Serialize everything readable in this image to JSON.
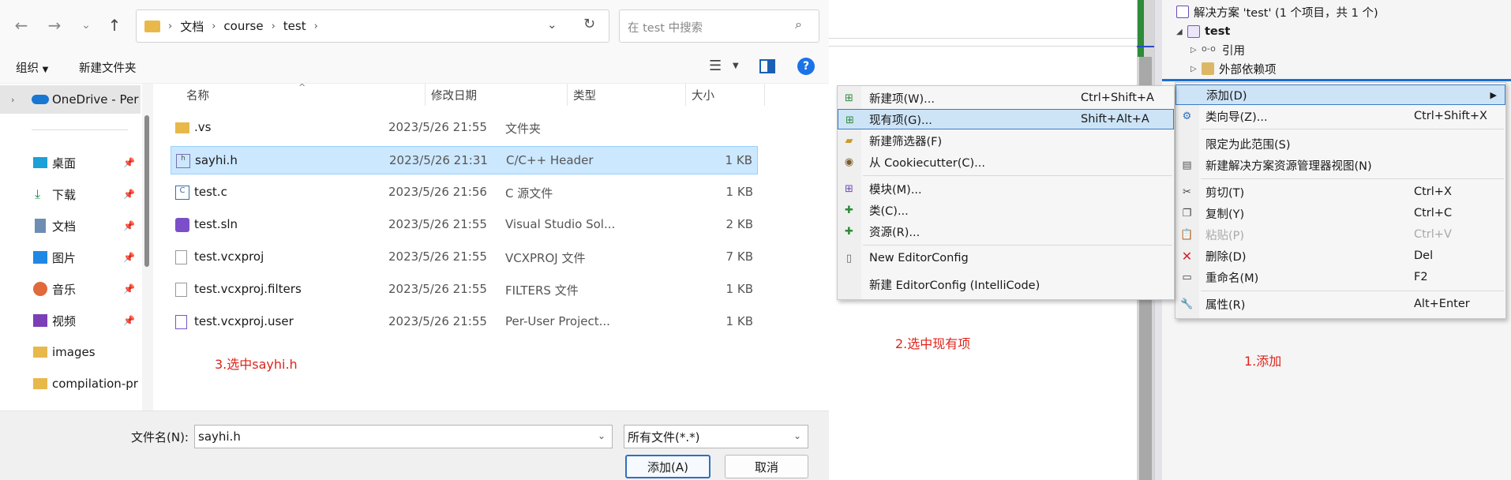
{
  "dialog": {
    "breadcrumb": [
      "文档",
      "course",
      "test"
    ],
    "search_placeholder": "在 test 中搜索",
    "toolbar": {
      "organize": "组织",
      "new_folder": "新建文件夹"
    },
    "columns": {
      "name": "名称",
      "modified": "修改日期",
      "type": "类型",
      "size": "大小"
    },
    "sidebar": [
      {
        "label": "OneDrive - Per",
        "pinned": false
      },
      {
        "label": "桌面",
        "pinned": true
      },
      {
        "label": "下载",
        "pinned": true
      },
      {
        "label": "文档",
        "pinned": true
      },
      {
        "label": "图片",
        "pinned": true
      },
      {
        "label": "音乐",
        "pinned": true
      },
      {
        "label": "视频",
        "pinned": true
      },
      {
        "label": "images",
        "pinned": false
      },
      {
        "label": "compilation-pr",
        "pinned": false
      }
    ],
    "files": [
      {
        "name": ".vs",
        "modified": "2023/5/26 21:55",
        "type": "文件夹",
        "size": ""
      },
      {
        "name": "sayhi.h",
        "modified": "2023/5/26 21:31",
        "type": "C/C++ Header",
        "size": "1 KB"
      },
      {
        "name": "test.c",
        "modified": "2023/5/26 21:56",
        "type": "C 源文件",
        "size": "1 KB"
      },
      {
        "name": "test.sln",
        "modified": "2023/5/26 21:55",
        "type": "Visual Studio Sol...",
        "size": "2 KB"
      },
      {
        "name": "test.vcxproj",
        "modified": "2023/5/26 21:55",
        "type": "VCXPROJ 文件",
        "size": "7 KB"
      },
      {
        "name": "test.vcxproj.filters",
        "modified": "2023/5/26 21:55",
        "type": "FILTERS 文件",
        "size": "1 KB"
      },
      {
        "name": "test.vcxproj.user",
        "modified": "2023/5/26 21:55",
        "type": "Per-User Project...",
        "size": "1 KB"
      }
    ],
    "filename_label": "文件名(N):",
    "filename_value": "sayhi.h",
    "filter_value": "所有文件(*.*)",
    "add_button": "添加(A)",
    "cancel_button": "取消"
  },
  "solution_explorer": {
    "solution": "解决方案 'test' (1 个项目，共 1 个)",
    "project": "test",
    "references": "引用",
    "external_deps": "外部依赖项"
  },
  "context_menu": [
    {
      "label": "添加(D)",
      "shortcut": "",
      "submenu": true,
      "selected": true
    },
    {
      "label": "类向导(Z)...",
      "shortcut": "Ctrl+Shift+X"
    },
    {
      "label": "限定为此范围(S)",
      "shortcut": ""
    },
    {
      "label": "新建解决方案资源管理器视图(N)",
      "shortcut": ""
    },
    {
      "label": "剪切(T)",
      "shortcut": "Ctrl+X"
    },
    {
      "label": "复制(Y)",
      "shortcut": "Ctrl+C"
    },
    {
      "label": "粘贴(P)",
      "shortcut": "Ctrl+V",
      "disabled": true
    },
    {
      "label": "删除(D)",
      "shortcut": "Del"
    },
    {
      "label": "重命名(M)",
      "shortcut": "F2"
    },
    {
      "label": "属性(R)",
      "shortcut": "Alt+Enter"
    }
  ],
  "add_submenu": [
    {
      "label": "新建项(W)...",
      "shortcut": "Ctrl+Shift+A"
    },
    {
      "label": "现有项(G)...",
      "shortcut": "Shift+Alt+A",
      "selected": true
    },
    {
      "label": "新建筛选器(F)",
      "shortcut": ""
    },
    {
      "label": "从 Cookiecutter(C)...",
      "shortcut": ""
    },
    {
      "label": "模块(M)...",
      "shortcut": ""
    },
    {
      "label": "类(C)...",
      "shortcut": ""
    },
    {
      "label": "资源(R)...",
      "shortcut": ""
    },
    {
      "label": "New EditorConfig",
      "shortcut": ""
    },
    {
      "label": "新建 EditorConfig (IntelliCode)",
      "shortcut": ""
    }
  ],
  "annotations": {
    "step1": "1.添加",
    "step2": "2.选中现有项",
    "step3": "3.选中sayhi.h"
  },
  "colors": {
    "selection": "#cce8ff",
    "menu_selection": "#cde4f7",
    "annotation": "#e0231b",
    "accent": "#2f70c0"
  }
}
